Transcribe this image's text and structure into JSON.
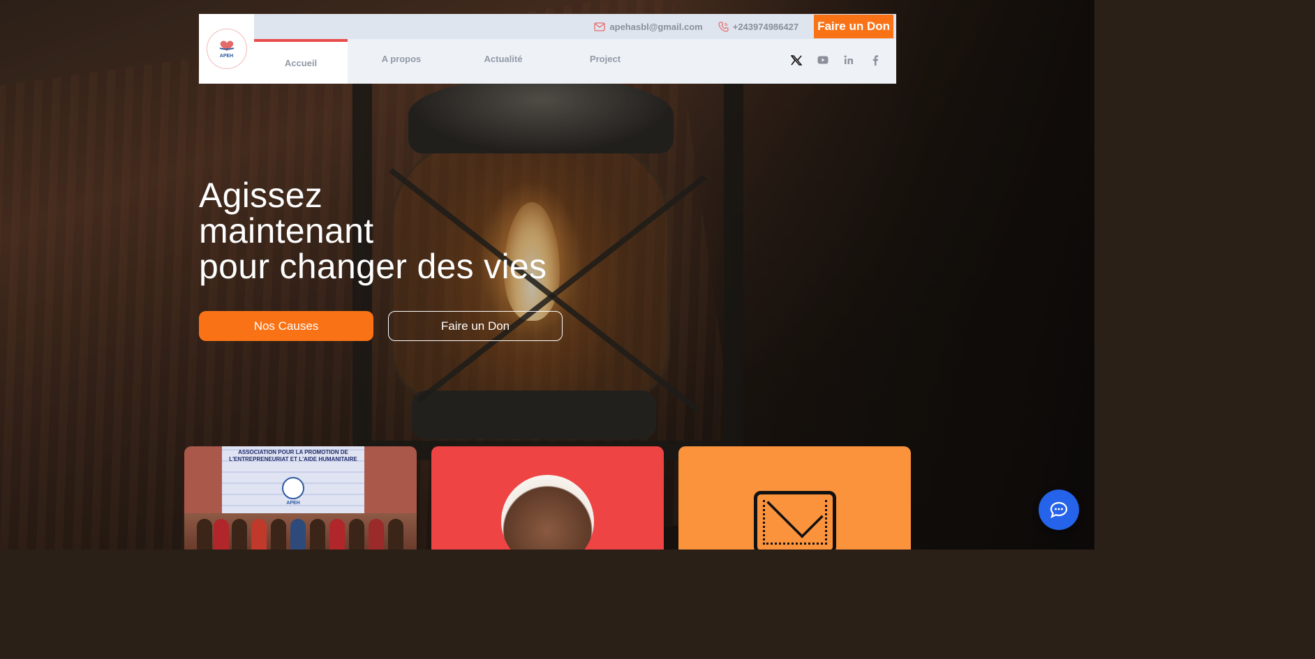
{
  "header": {
    "logo_text": "APEH",
    "email": "apehasbl@gmail.com",
    "phone": "+243974986427",
    "top_donate_label": "Faire un Don",
    "nav": [
      {
        "label": "Accueil",
        "active": true
      },
      {
        "label": "A propos",
        "active": false
      },
      {
        "label": "Actualité",
        "active": false
      },
      {
        "label": "Project",
        "active": false
      }
    ],
    "social_icons": [
      "x-icon",
      "youtube-icon",
      "linkedin-icon",
      "facebook-icon"
    ]
  },
  "hero": {
    "title_lines": [
      "Agissez",
      "maintenant",
      "pour changer des vies"
    ],
    "primary_button": "Nos Causes",
    "secondary_button": "Faire un Don"
  },
  "cards": [
    {
      "image": "group-photo",
      "banner_text": "ASSOCIATION POUR LA PROMOTION DE L'ENTREPRENEURIAT ET L'AIDE HUMANITAIRE",
      "banner_sub": "APEH",
      "color": "#a9584a"
    },
    {
      "image": "hands-together-photo",
      "color": "#ef4444"
    },
    {
      "image": "envelope-icon",
      "color": "#fb923c"
    }
  ],
  "colors": {
    "accent": "#f97316",
    "nav_active": "#e94a4a",
    "chat": "#2563eb"
  }
}
